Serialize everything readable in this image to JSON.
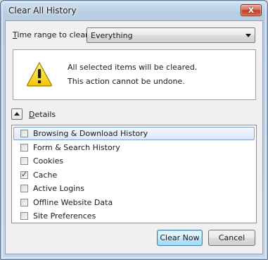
{
  "window": {
    "title": "Clear All History",
    "close_glyph": "x"
  },
  "time_range": {
    "label_mnemonic": "T",
    "label_rest": "ime range to clear:",
    "selected": "Everything"
  },
  "warning": {
    "icon": "warning-icon",
    "line1": "All selected items will be cleared.",
    "line2": "This action cannot be undone."
  },
  "details": {
    "label_mnemonic": "D",
    "label_rest": "etails",
    "items": [
      {
        "label": "Browsing & Download History",
        "checked": false,
        "focused": true
      },
      {
        "label": "Form & Search History",
        "checked": false
      },
      {
        "label": "Cookies",
        "checked": false
      },
      {
        "label": "Cache",
        "checked": true
      },
      {
        "label": "Active Logins",
        "checked": false
      },
      {
        "label": "Offline Website Data",
        "checked": false
      },
      {
        "label": "Site Preferences",
        "checked": false
      }
    ]
  },
  "buttons": {
    "clear_now": "Clear Now",
    "cancel": "Cancel"
  },
  "colors": {
    "focus_border": "#7da2ce",
    "default_button_border": "#3c7fb1",
    "close_button": "#c2422c"
  }
}
